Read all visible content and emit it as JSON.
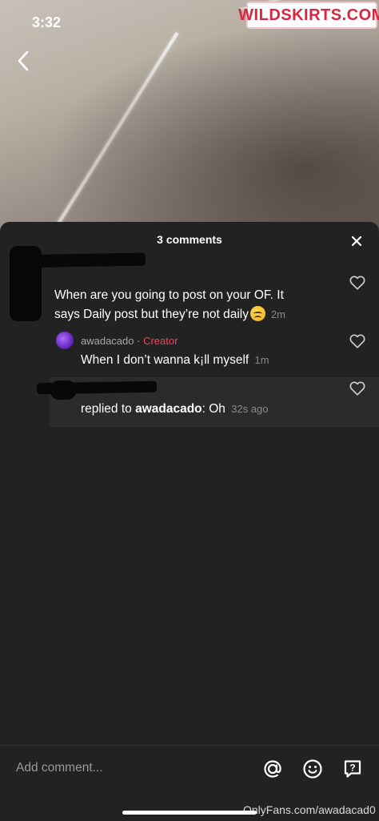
{
  "status_bar": {
    "time": "3:32"
  },
  "watermark_top": "WILDSKIRTS.COM",
  "sheet": {
    "title": "3 comments"
  },
  "comment": {
    "text_line1": "When are you going to post on your OF. It",
    "text_line2": "says Daily post but they’re not daily",
    "emoji": "disappointed-face-emoji",
    "time": "2m"
  },
  "reply": {
    "username": "awadacado",
    "separator": "·",
    "badge": "Creator",
    "text": "When I don’t wanna k¡ll myself",
    "time": "1m"
  },
  "nested_reply": {
    "prefix": "replied to ",
    "reply_to": "awadacado",
    "text": ": Oh",
    "time": "32s ago"
  },
  "input": {
    "placeholder": "Add comment...",
    "icons": [
      "at-mention-icon",
      "emoji-icon",
      "question-sticker-icon"
    ]
  },
  "footer_watermark": "OnlyFans.com/awadacad0",
  "colors": {
    "sheet_bg": "#222222",
    "creator_badge": "#f0445b",
    "muted_text": "#8a8a8a"
  }
}
